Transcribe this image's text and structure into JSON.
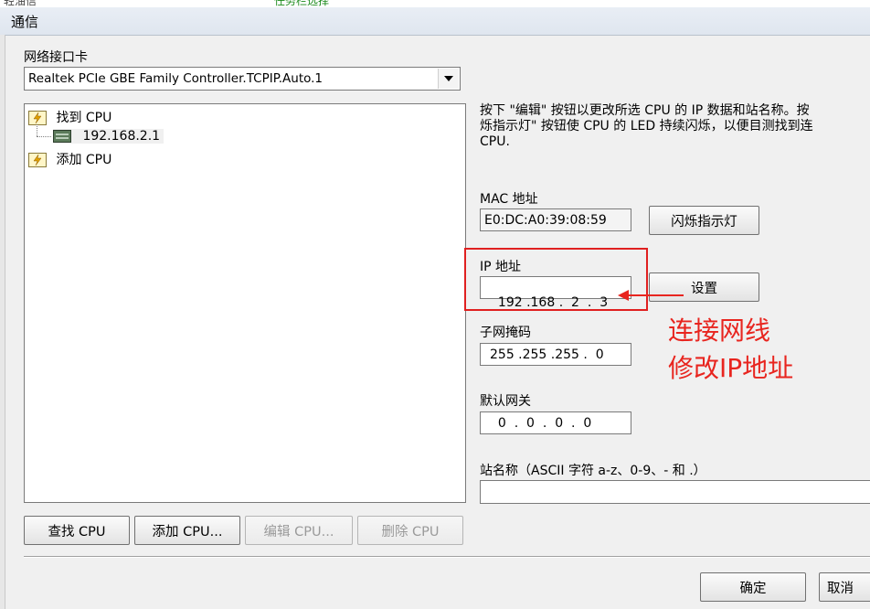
{
  "background_fragments": [
    "轻油信",
    "任务栏选择"
  ],
  "window": {
    "title": "通信"
  },
  "nic": {
    "label": "网络接口卡",
    "selected": "Realtek PCIe GBE Family Controller.TCPIP.Auto.1"
  },
  "tree": {
    "found_label": "找到 CPU",
    "found_ip": "192.168.2.1",
    "add_label": "添加 CPU"
  },
  "description": {
    "line1": "按下 \"编辑\" 按钮以更改所选 CPU 的 IP 数据和站名称。按",
    "line2": "烁指示灯\" 按钮使 CPU 的 LED 持续闪烁，以便目测找到连",
    "line3": "CPU."
  },
  "mac": {
    "label": "MAC 地址",
    "value": "E0:DC:A0:39:08:59",
    "button": "闪烁指示灯"
  },
  "ip": {
    "label": "IP 地址",
    "value": "192 .168 .  2  .  3",
    "button": "设置"
  },
  "subnet": {
    "label": "子网掩码",
    "value": "255 .255 .255 .  0"
  },
  "gateway": {
    "label": "默认网关",
    "value": "  0  .  0  .  0  .  0"
  },
  "station": {
    "label": "站名称（ASCII 字符 a-z、0-9、- 和 .）",
    "value": ""
  },
  "buttons": {
    "find": "查找 CPU",
    "add": "添加 CPU...",
    "edit": "编辑 CPU...",
    "delete": "删除 CPU",
    "ok": "确定",
    "cancel": "取消"
  },
  "annotation": {
    "line1": "连接网线",
    "line2": "修改IP地址",
    "color": "#e8251f"
  }
}
